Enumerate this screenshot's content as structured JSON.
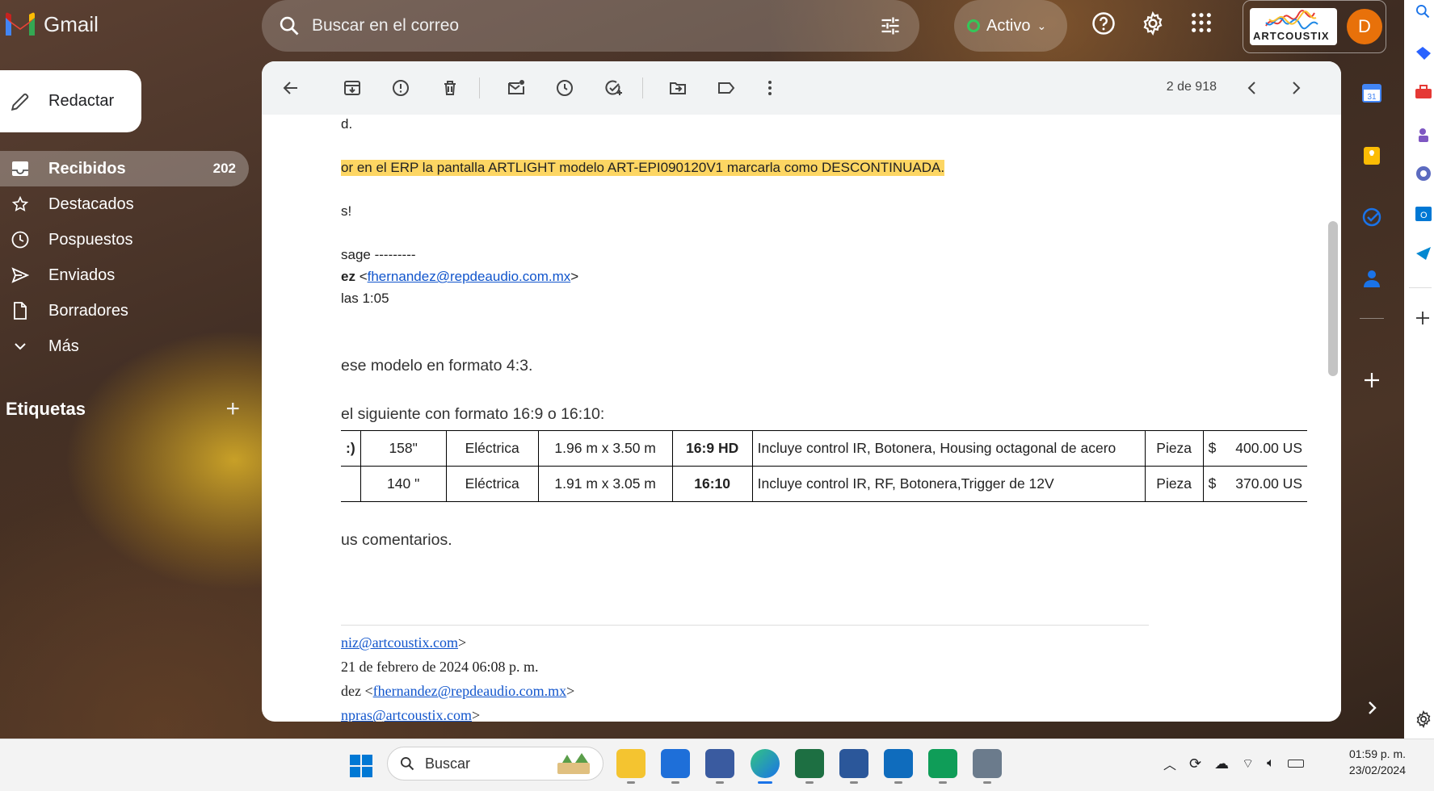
{
  "app": {
    "name": "Gmail"
  },
  "search": {
    "placeholder": "Buscar en el correo"
  },
  "status": {
    "label": "Activo",
    "color": "#34c759"
  },
  "account": {
    "brand": "ARTCOUSTIX",
    "avatar_letter": "D",
    "avatar_color": "#e8710a"
  },
  "compose": {
    "label": "Redactar"
  },
  "nav": {
    "items": [
      {
        "label": "Recibidos",
        "count": "202",
        "icon": "inbox-icon"
      },
      {
        "label": "Destacados",
        "icon": "star-icon"
      },
      {
        "label": "Pospuestos",
        "icon": "clock-icon"
      },
      {
        "label": "Enviados",
        "icon": "send-icon"
      },
      {
        "label": "Borradores",
        "icon": "draft-icon"
      },
      {
        "label": "Más",
        "icon": "chevron-down-icon"
      }
    ]
  },
  "labels": {
    "title": "Etiquetas",
    "add": "+"
  },
  "toolbar": {
    "pager": "2 de 918"
  },
  "email": {
    "line1": "d.",
    "highlight": "or en el ERP la pantalla ARTLIGHT  modelo ART-EPI090120V1 marcarla como DESCONTINUADA.",
    "line3": "s!",
    "fwd_header": "sage ---------",
    "from_name": "ez",
    "from_email": "fhernandez@repdeaudio.com.mx",
    "date_line": "las 1:05",
    "body1": "ese modelo en formato 4:3.",
    "body2": "el siguiente con formato 16:9 o 16:10:",
    "table": [
      [
        ":)",
        "158\"",
        "Eléctrica",
        "1.96 m x 3.50 m",
        "16:9 HD",
        "Incluye control IR, Botonera, Housing octagonal de acero",
        "Pieza",
        "$",
        "400.00 US"
      ],
      [
        "",
        "140 \"",
        "Eléctrica",
        "1.91 m x 3.05 m",
        "16:10",
        "Incluye control IR, RF, Botonera,Trigger de  12V",
        "Pieza",
        "$",
        "370.00 US"
      ]
    ],
    "body3": "us comentarios.",
    "quoted_email1": "niz@artcoustix.com",
    "quoted_date": "21 de febrero de 2024 06:08 p. m.",
    "quoted_name": "dez <",
    "quoted_email2": "fhernandez@repdeaudio.com.mx",
    "quoted_email3": "npras@artcoustix.com"
  },
  "taskbar": {
    "search_label": "Buscar",
    "time": "01:59 p. m.",
    "date": "23/02/2024"
  }
}
